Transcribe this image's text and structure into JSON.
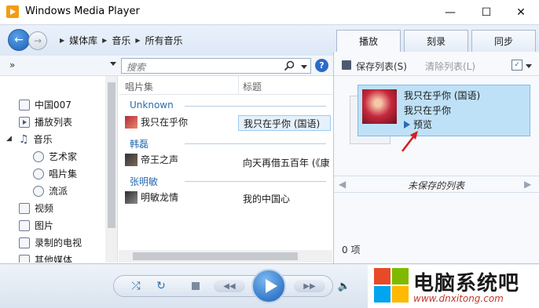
{
  "window": {
    "title": "Windows Media Player"
  },
  "nav": {
    "breadcrumbs": [
      "媒体库",
      "音乐",
      "所有音乐"
    ]
  },
  "tabs": [
    {
      "label": "播放"
    },
    {
      "label": "刻录"
    },
    {
      "label": "同步"
    }
  ],
  "toolbar": {
    "organize": "»",
    "search_placeholder": "搜索"
  },
  "sidebar": {
    "items": [
      {
        "label": "中国007"
      },
      {
        "label": "播放列表"
      },
      {
        "label": "音乐"
      },
      {
        "label": "艺术家"
      },
      {
        "label": "唱片集"
      },
      {
        "label": "流派"
      },
      {
        "label": "视频"
      },
      {
        "label": "图片"
      },
      {
        "label": "录制的电视"
      },
      {
        "label": "其他媒体"
      }
    ]
  },
  "list": {
    "columns": [
      "唱片集",
      "标题"
    ],
    "groups": [
      {
        "artist": "Unknown",
        "album": "我只在乎你",
        "title": "我只在乎你 (国语)"
      },
      {
        "artist": "韩磊",
        "album": "帝王之声",
        "title": "向天再借五百年 (《康"
      },
      {
        "artist": "张明敏",
        "album": "明敏龙情",
        "title": "我的中国心"
      }
    ]
  },
  "playlist_pane": {
    "save_label": "保存列表(S)",
    "clear_label": "清除列表(L)",
    "drag_item": {
      "title": "我只在乎你 (国语)",
      "subtitle": "我只在乎你",
      "preview_label": "预览"
    },
    "unsaved_label": "未保存的列表",
    "count_label": "0 项"
  },
  "watermark": {
    "name": "电脑系统吧",
    "url": "www.dnxitong.com"
  }
}
